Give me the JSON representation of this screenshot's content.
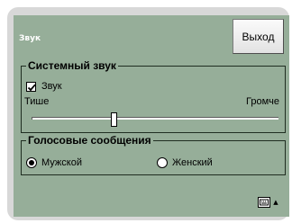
{
  "window": {
    "title": "Звук",
    "exit_label": "Выход"
  },
  "system_sound": {
    "legend": "Системный звук",
    "checkbox_label": "Звук",
    "checkbox_checked": true,
    "min_label": "Тише",
    "max_label": "Громче",
    "volume_fraction": 0.33
  },
  "voice_messages": {
    "legend": "Голосовые сообщения",
    "options": [
      {
        "label": "Мужской",
        "selected": true
      },
      {
        "label": "Женский",
        "selected": false
      }
    ]
  },
  "icons": {
    "keyboard": "keyboard-icon",
    "input_menu_arrow": "chevron-up-icon"
  },
  "colors": {
    "panel": "#96ae99",
    "frame": "#d8d8d8",
    "title_text": "#ffffff"
  }
}
